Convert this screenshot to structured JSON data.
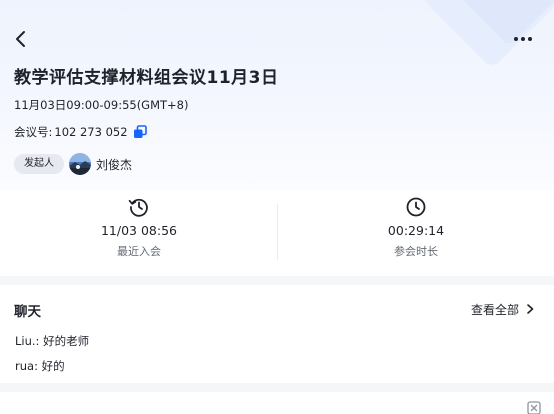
{
  "meeting": {
    "title": "教学评估支撑材料组会议11月3日",
    "time": "11月03日09:00-09:55(GMT+8)",
    "id_label": "会议号:",
    "id_value": "102 273 052",
    "initiator_badge": "发起人",
    "initiator_name": "刘俊杰"
  },
  "stats": [
    {
      "icon": "history-icon",
      "value": "11/03 08:56",
      "label": "最近入会"
    },
    {
      "icon": "clock-icon",
      "value": "00:29:14",
      "label": "参会时长"
    }
  ],
  "chat": {
    "title": "聊天",
    "view_all": "查看全部",
    "messages": [
      {
        "sender": "Liu.:",
        "text": "好的老师"
      },
      {
        "sender": "rua:",
        "text": "好的"
      }
    ]
  },
  "colors": {
    "accent": "#1664ff",
    "header_bg": "#eef3fd",
    "text_primary": "#1f2329",
    "text_secondary": "#646a73",
    "separator": "#f5f6f7"
  },
  "icons": {
    "back": "chevron-left-icon",
    "more": "more-horizontal-icon",
    "copy": "copy-icon",
    "view_all": "chevron-right-icon",
    "corner": "close-box-icon"
  }
}
